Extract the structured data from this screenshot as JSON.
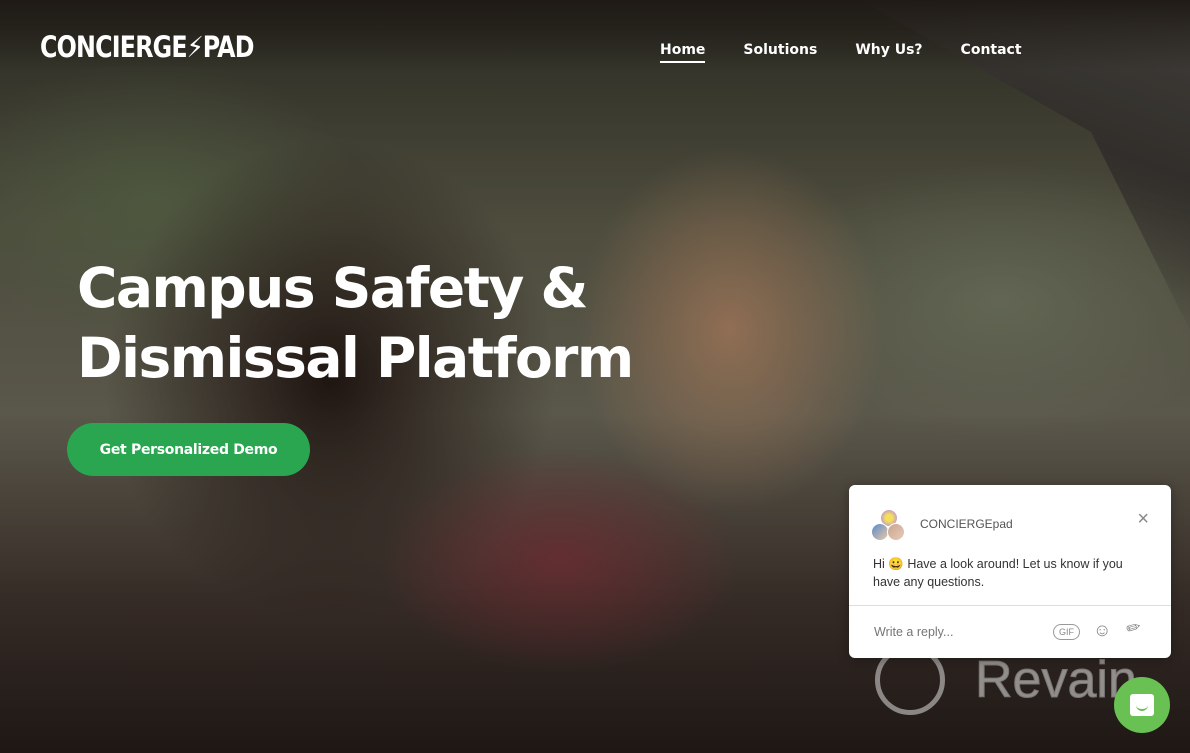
{
  "header": {
    "logo_text_1": "CONCIERGE",
    "logo_bolt": "⚡",
    "logo_text_2": "PAD",
    "nav": [
      {
        "label": "Home",
        "active": true
      },
      {
        "label": "Solutions",
        "active": false
      },
      {
        "label": "Why Us?",
        "active": false
      },
      {
        "label": "Contact",
        "active": false
      }
    ]
  },
  "hero": {
    "title_line_1": "Campus Safety &",
    "title_line_2": "Dismissal Platform",
    "cta_label": "Get Personalized Demo",
    "cta_color": "#2aa651"
  },
  "chat_widget": {
    "company_name": "CONCIERGEpad",
    "close_icon": "×",
    "message": "Hi 😀 Have a look around! Let us know if you have any questions.",
    "reply_placeholder": "Write a reply...",
    "gif_label": "GIF",
    "emoji_icon": "☺",
    "attach_icon": "📎",
    "launcher_color": "#68c152"
  },
  "watermark": {
    "text": "Revain"
  }
}
